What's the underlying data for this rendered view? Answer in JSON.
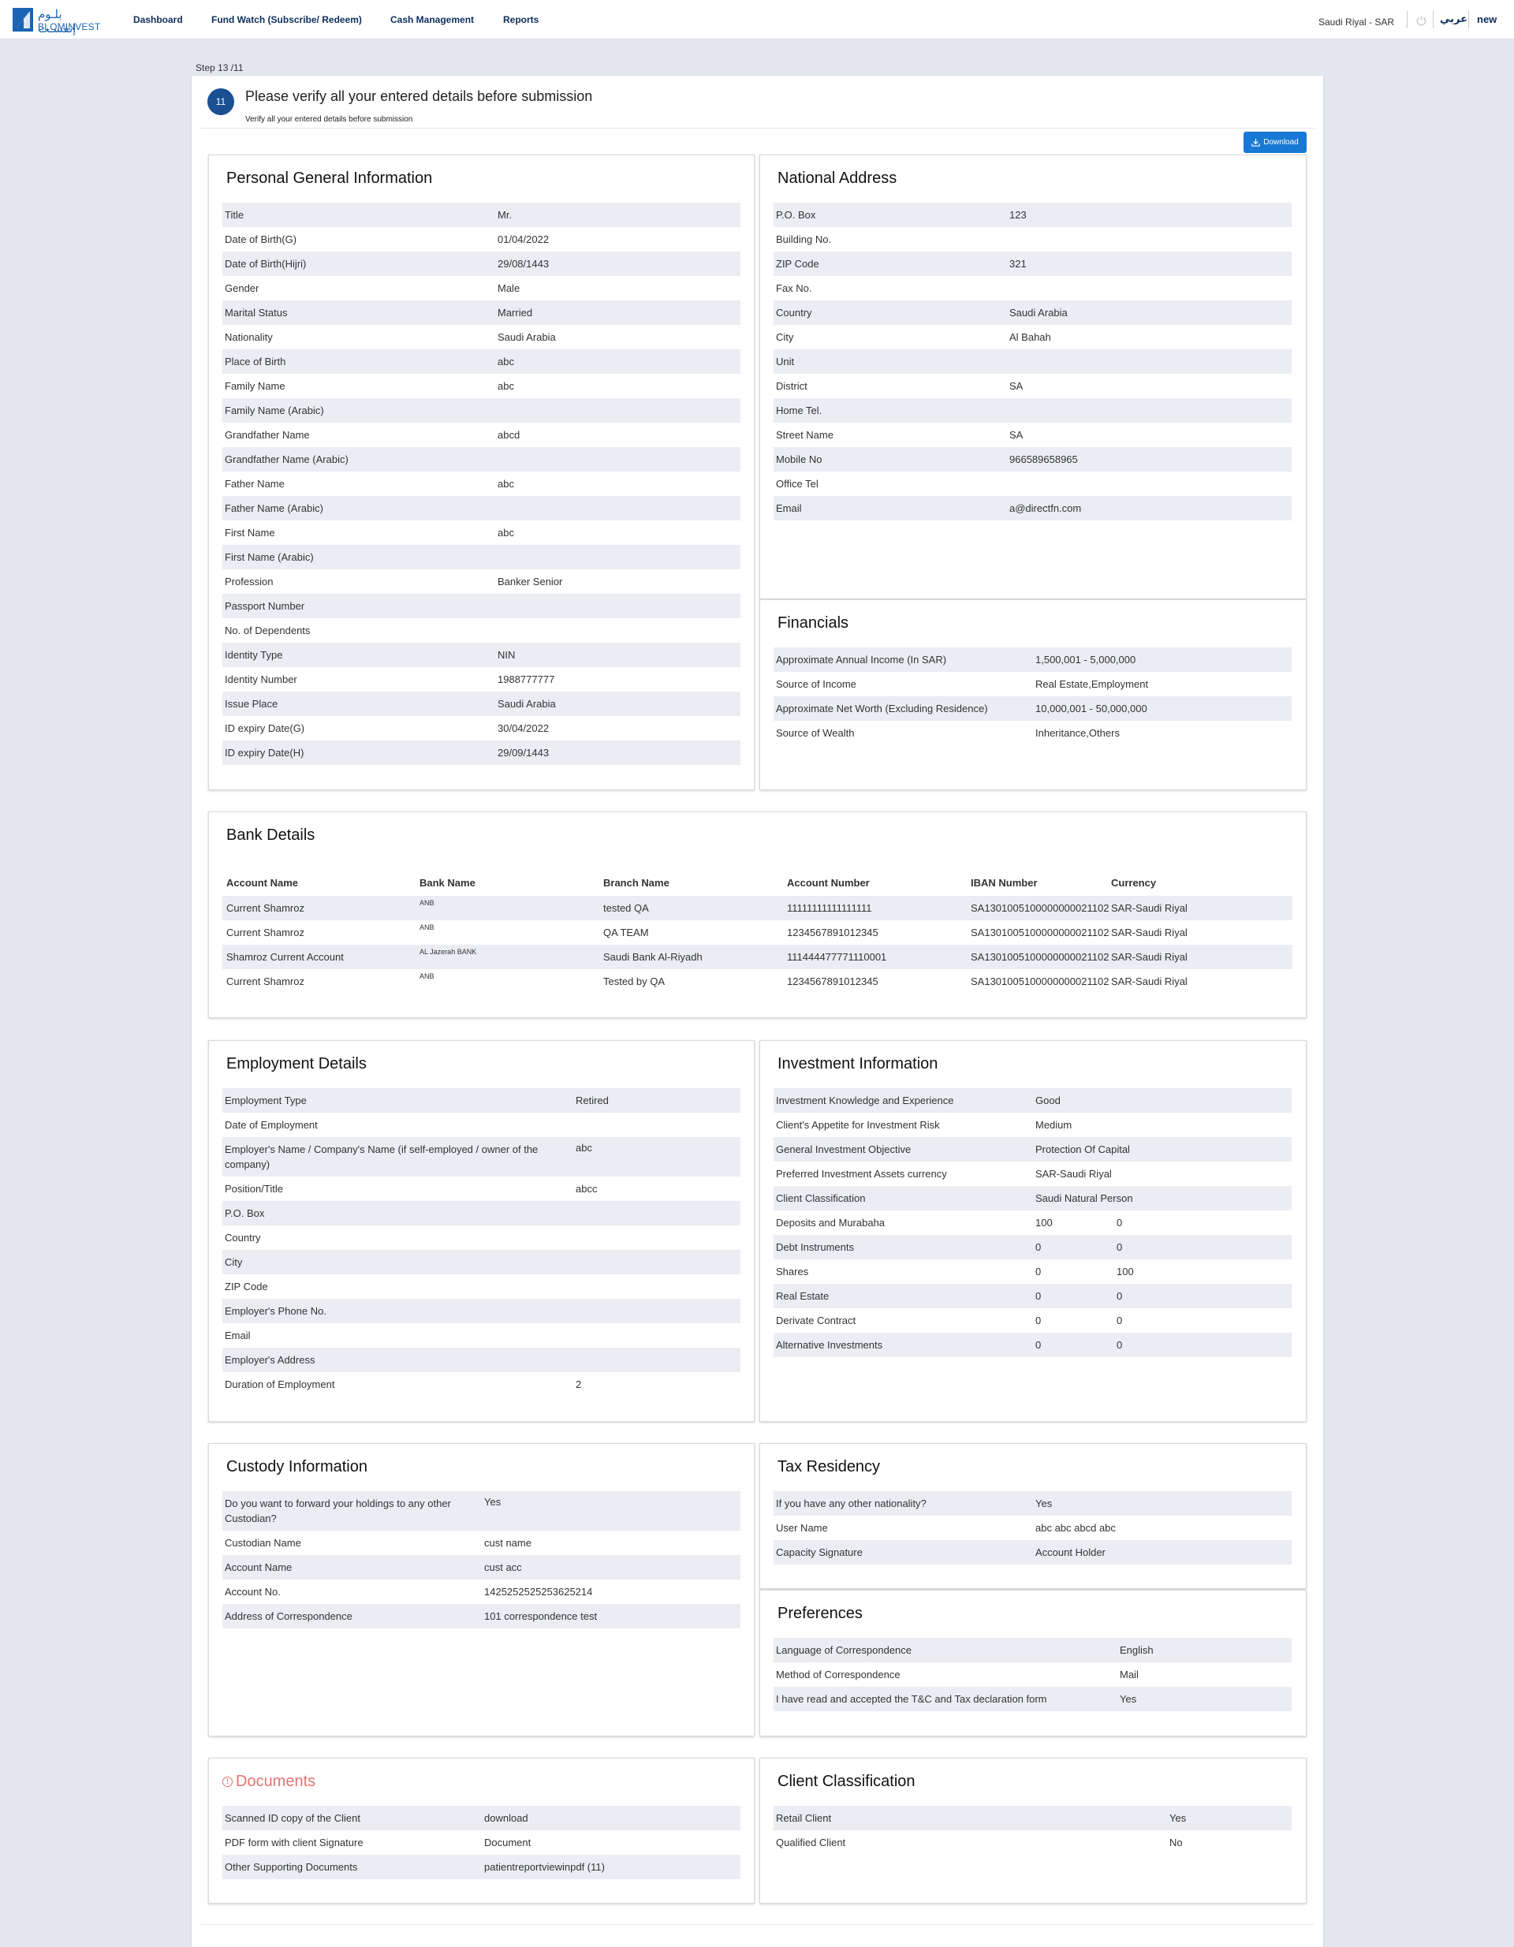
{
  "header": {
    "logo_ar": "بلـوم إنفسـت",
    "logo_en": "BLOMINVEST",
    "nav": [
      "Dashboard",
      "Fund Watch (Subscribe/ Redeem)",
      "Cash Management",
      "Reports"
    ],
    "currency": "Saudi Riyal - SAR",
    "language": "عربي",
    "user": "new"
  },
  "step": {
    "label": "Step 13 /11",
    "number": "11",
    "title": "Please verify all your entered details before submission",
    "subtitle": "Verify all your entered details before submission",
    "download_label": "Download"
  },
  "personal": {
    "title": "Personal General Information",
    "rows": [
      {
        "k": "Title",
        "v": "Mr."
      },
      {
        "k": "Date of Birth(G)",
        "v": "01/04/2022"
      },
      {
        "k": "Date of Birth(Hijri)",
        "v": "29/08/1443"
      },
      {
        "k": "Gender",
        "v": "Male"
      },
      {
        "k": "Marital Status",
        "v": "Married"
      },
      {
        "k": "Nationality",
        "v": "Saudi Arabia"
      },
      {
        "k": "Place of Birth",
        "v": "abc"
      },
      {
        "k": "Family Name",
        "v": "abc"
      },
      {
        "k": "Family Name (Arabic)",
        "v": ""
      },
      {
        "k": "Grandfather Name",
        "v": "abcd"
      },
      {
        "k": "Grandfather Name (Arabic)",
        "v": ""
      },
      {
        "k": "Father Name",
        "v": "abc"
      },
      {
        "k": "Father Name (Arabic)",
        "v": ""
      },
      {
        "k": "First Name",
        "v": "abc"
      },
      {
        "k": "First Name (Arabic)",
        "v": ""
      },
      {
        "k": "Profession",
        "v": "Banker Senior"
      },
      {
        "k": "Passport Number",
        "v": ""
      },
      {
        "k": "No. of Dependents",
        "v": ""
      },
      {
        "k": "Identity Type",
        "v": "NIN"
      },
      {
        "k": "Identity Number",
        "v": "1988777777"
      },
      {
        "k": "Issue Place",
        "v": "Saudi Arabia"
      },
      {
        "k": "ID expiry Date(G)",
        "v": "30/04/2022"
      },
      {
        "k": "ID expiry Date(H)",
        "v": "29/09/1443"
      }
    ]
  },
  "address": {
    "title": "National Address",
    "rows": [
      {
        "k": "P.O. Box",
        "v": "123"
      },
      {
        "k": "Building No.",
        "v": ""
      },
      {
        "k": "ZIP Code",
        "v": "321"
      },
      {
        "k": "Fax No.",
        "v": ""
      },
      {
        "k": "Country",
        "v": "Saudi Arabia"
      },
      {
        "k": "City",
        "v": "Al Bahah"
      },
      {
        "k": "Unit",
        "v": ""
      },
      {
        "k": "District",
        "v": "SA"
      },
      {
        "k": "Home Tel.",
        "v": ""
      },
      {
        "k": "Street Name",
        "v": "SA"
      },
      {
        "k": "Mobile No",
        "v": "966589658965"
      },
      {
        "k": "Office Tel",
        "v": ""
      },
      {
        "k": "Email",
        "v": "a@directfn.com"
      }
    ]
  },
  "financials": {
    "title": "Financials",
    "rows": [
      {
        "k": "Approximate Annual Income (In SAR)",
        "v": "1,500,001 - 5,000,000"
      },
      {
        "k": "Source of Income",
        "v": "Real Estate,Employment"
      },
      {
        "k": "Approximate Net Worth (Excluding Residence)",
        "v": "10,000,001 - 50,000,000"
      },
      {
        "k": "Source of Wealth",
        "v": "Inheritance,Others"
      }
    ]
  },
  "bank": {
    "title": "Bank Details",
    "headers": [
      "Account Name",
      "Bank Name",
      "Branch Name",
      "Account Number",
      "IBAN Number",
      "Currency"
    ],
    "rows": [
      [
        "Current Shamroz",
        "ANB",
        "tested QA",
        "11111111111111111",
        "SA1301005100000000021102",
        "SAR-Saudi Riyal"
      ],
      [
        "Current Shamroz",
        "ANB",
        "QA TEAM",
        "1234567891012345",
        "SA1301005100000000021102",
        "SAR-Saudi Riyal"
      ],
      [
        "Shamroz Current Account",
        "AL Jazerah BANK",
        "Saudi Bank Al-Riyadh",
        "111444477771110001",
        "SA1301005100000000021102",
        "SAR-Saudi Riyal"
      ],
      [
        "Current Shamroz",
        "ANB",
        "Tested by QA",
        "1234567891012345",
        "SA1301005100000000021102",
        "SAR-Saudi Riyal"
      ]
    ]
  },
  "employment": {
    "title": "Employment Details",
    "rows": [
      {
        "k": "Employment Type",
        "v": "Retired"
      },
      {
        "k": "Date of Employment",
        "v": ""
      },
      {
        "k": "Employer's Name / Company's Name (if self-employed / owner of the company)",
        "v": "abc"
      },
      {
        "k": "Position/Title",
        "v": "abcc"
      },
      {
        "k": "P.O. Box",
        "v": ""
      },
      {
        "k": "Country",
        "v": ""
      },
      {
        "k": "City",
        "v": ""
      },
      {
        "k": "ZIP Code",
        "v": ""
      },
      {
        "k": "Employer's Phone No.",
        "v": ""
      },
      {
        "k": "Email",
        "v": ""
      },
      {
        "k": "Employer's Address",
        "v": ""
      },
      {
        "k": "Duration of Employment",
        "v": "2"
      }
    ]
  },
  "investment": {
    "title": "Investment Information",
    "rows": [
      {
        "k": "Investment Knowledge and Experience",
        "v": "Good",
        "v2": ""
      },
      {
        "k": "Client's Appetite for Investment Risk",
        "v": "Medium",
        "v2": ""
      },
      {
        "k": "General Investment Objective",
        "v": "Protection Of Capital",
        "v2": ""
      },
      {
        "k": "Preferred Investment Assets currency",
        "v": "SAR-Saudi Riyal",
        "v2": ""
      },
      {
        "k": "Client Classification",
        "v": "Saudi Natural Person",
        "v2": ""
      },
      {
        "k": "Deposits and Murabaha",
        "v": "100",
        "v2": "0"
      },
      {
        "k": "Debt Instruments",
        "v": "0",
        "v2": "0"
      },
      {
        "k": "Shares",
        "v": "0",
        "v2": "100"
      },
      {
        "k": "Real Estate",
        "v": "0",
        "v2": "0"
      },
      {
        "k": "Derivate Contract",
        "v": "0",
        "v2": "0"
      },
      {
        "k": "Alternative Investments",
        "v": "0",
        "v2": "0"
      }
    ]
  },
  "custody": {
    "title": "Custody Information",
    "rows": [
      {
        "k": "Do you want to forward your holdings to any other Custodian?",
        "v": "Yes"
      },
      {
        "k": "Custodian Name",
        "v": "cust name"
      },
      {
        "k": "Account Name",
        "v": "cust acc"
      },
      {
        "k": "Account No.",
        "v": "1425252525253625214"
      },
      {
        "k": "Address of Correspondence",
        "v": "101 correspondence test"
      }
    ]
  },
  "tax": {
    "title": "Tax Residency",
    "rows": [
      {
        "k": "If you have any other nationality?",
        "v": "Yes"
      },
      {
        "k": "User Name",
        "v": "abc abc abcd abc"
      },
      {
        "k": "Capacity Signature",
        "v": "Account Holder"
      }
    ]
  },
  "preferences": {
    "title": "Preferences",
    "rows": [
      {
        "k": "Language of Correspondence",
        "v": "English"
      },
      {
        "k": "Method of Correspondence",
        "v": "Mail"
      },
      {
        "k": "I have read and accepted the T&C and Tax declaration form",
        "v": "Yes"
      }
    ]
  },
  "documents": {
    "title": "Documents",
    "rows": [
      {
        "k": "Scanned ID copy of the Client",
        "v": "download"
      },
      {
        "k": "PDF form with client Signature",
        "v": "Document"
      },
      {
        "k": "Other Supporting Documents",
        "v": "patientreportviewinpdf (11)"
      }
    ]
  },
  "classification": {
    "title": "Client Classification",
    "rows": [
      {
        "k": "Retail Client",
        "v": "Yes"
      },
      {
        "k": "Qualified Client",
        "v": "No"
      }
    ]
  }
}
